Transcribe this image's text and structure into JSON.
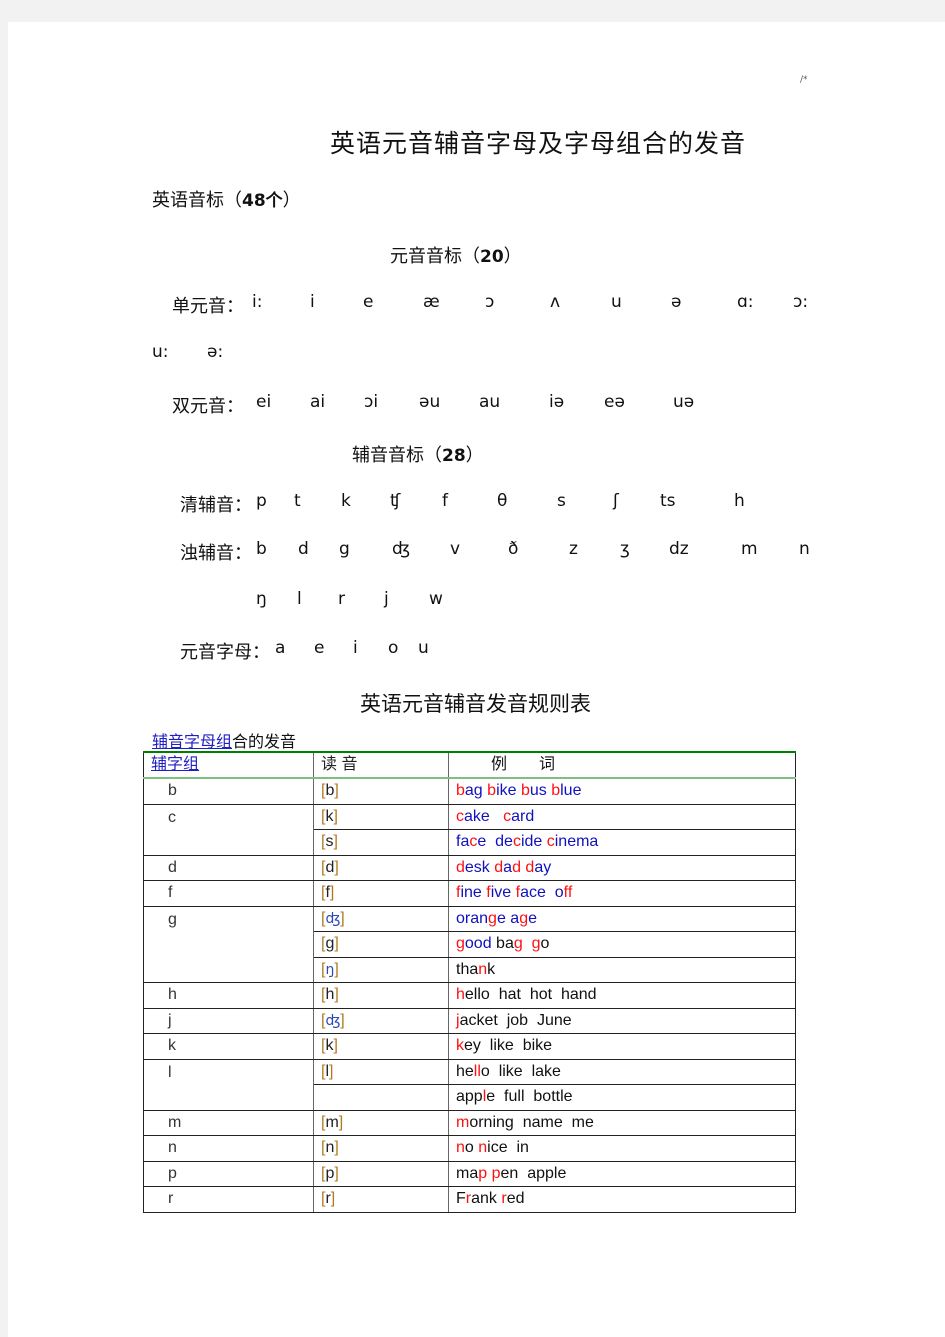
{
  "page_mark": "/*",
  "document_title": "英语元音辅音字母及字母组合的发音",
  "phonetics_heading": {
    "text": "英语音标（",
    "count": "48个",
    "close": "）"
  },
  "vowel_heading": {
    "text": "元音音标（",
    "count": "20",
    "close": "）"
  },
  "monophthongs": {
    "label": "单元音：",
    "symbols": [
      "i:",
      "i",
      "e",
      "æ",
      "ɔ",
      "ʌ",
      "u",
      "ə",
      "ɑ:",
      "ɔ:",
      "u:",
      "ə:"
    ]
  },
  "diphthongs": {
    "label": "双元音：",
    "symbols": [
      "ei",
      "ai",
      "ɔi",
      "əu",
      "au",
      "iə",
      "eə",
      "uə"
    ]
  },
  "consonant_heading": {
    "text": "辅音音标（",
    "count": "28",
    "close": "）"
  },
  "voiceless": {
    "label": "清辅音：",
    "symbols": [
      "p",
      "t",
      "k",
      "ʧ",
      "f",
      "θ",
      "s",
      "ʃ",
      "ts",
      "h"
    ]
  },
  "voiced": {
    "label": "浊辅音：",
    "symbols": [
      "b",
      "d",
      "g",
      "ʤ",
      "v",
      "ð",
      "z",
      "ʒ",
      "dz",
      "m",
      "n",
      "ŋ",
      "l",
      "r",
      "j",
      "w"
    ]
  },
  "vowel_letters": {
    "label": "元音字母：",
    "letters": [
      "a",
      "e",
      "i",
      "o",
      "u"
    ]
  },
  "table_title": "英语元音辅音发音规则表",
  "section_heading": {
    "link": "辅音字母组",
    "rest": "合的发音"
  },
  "table": {
    "headers": [
      "辅字组",
      "读 音",
      "例　　词"
    ],
    "rows": [
      {
        "group": "b",
        "sound": "b",
        "examples": [
          [
            "r",
            "b"
          ],
          [
            "b",
            "ag "
          ],
          [
            "r",
            "b"
          ],
          [
            "b",
            "ike "
          ],
          [
            "r",
            "b"
          ],
          [
            "b",
            "us "
          ],
          [
            "r",
            "b"
          ],
          [
            "b",
            "lue"
          ]
        ]
      },
      {
        "group": "c",
        "sound": "k",
        "examples": [
          [
            "r",
            "c"
          ],
          [
            "b",
            "ake   "
          ],
          [
            "r",
            "c"
          ],
          [
            "b",
            "ard"
          ]
        ]
      },
      {
        "group": "",
        "sound": "s",
        "examples": [
          [
            "b",
            "fa"
          ],
          [
            "r",
            "c"
          ],
          [
            "b",
            "e  de"
          ],
          [
            "r",
            "c"
          ],
          [
            "b",
            "ide "
          ],
          [
            "r",
            "c"
          ],
          [
            "b",
            "inema"
          ]
        ]
      },
      {
        "group": "d",
        "sound": "d",
        "examples": [
          [
            "r",
            "d"
          ],
          [
            "b",
            "esk "
          ],
          [
            "r",
            "d"
          ],
          [
            "b",
            "a"
          ],
          [
            "r",
            "d"
          ],
          [
            "b",
            " "
          ],
          [
            "r",
            "d"
          ],
          [
            "b",
            "ay"
          ]
        ]
      },
      {
        "group": "f",
        "sound": "f",
        "examples": [
          [
            "r",
            "f"
          ],
          [
            "b",
            "ine "
          ],
          [
            "r",
            "f"
          ],
          [
            "b",
            "ive "
          ],
          [
            "r",
            "f"
          ],
          [
            "b",
            "ace  o"
          ],
          [
            "r",
            "ff"
          ]
        ]
      },
      {
        "group": "g",
        "sound": "ʤ",
        "examples": [
          [
            "b",
            "oran"
          ],
          [
            "r",
            "g"
          ],
          [
            "b",
            "e a"
          ],
          [
            "r",
            "g"
          ],
          [
            "b",
            "e"
          ]
        ]
      },
      {
        "group": "",
        "sound": "g",
        "examples": [
          [
            "r",
            "g"
          ],
          [
            "b",
            "ood "
          ],
          [
            "k",
            "ba"
          ],
          [
            "r",
            "g"
          ],
          [
            "k",
            "  "
          ],
          [
            "r",
            "g"
          ],
          [
            "k",
            "o"
          ]
        ]
      },
      {
        "group": "",
        "sound": "ŋ",
        "examples": [
          [
            "k",
            "tha"
          ],
          [
            "r",
            "n"
          ],
          [
            "k",
            "k"
          ]
        ]
      },
      {
        "group": "h",
        "sound": "h",
        "examples": [
          [
            "r",
            "h"
          ],
          [
            "k",
            "ello  hat  hot  hand"
          ]
        ]
      },
      {
        "group": "j",
        "sound": "ʤ",
        "examples": [
          [
            "r",
            "j"
          ],
          [
            "k",
            "acket  job  June"
          ]
        ]
      },
      {
        "group": "k",
        "sound": "k",
        "examples": [
          [
            "r",
            "k"
          ],
          [
            "k",
            "ey  like  bike"
          ]
        ]
      },
      {
        "group": "l",
        "sound": "l",
        "examples": [
          [
            "k",
            "he"
          ],
          [
            "r",
            "ll"
          ],
          [
            "k",
            "o  like  lake"
          ]
        ]
      },
      {
        "group": "",
        "sound": "",
        "examples": [
          [
            "k",
            "app"
          ],
          [
            "r",
            "l"
          ],
          [
            "k",
            "e  full  bottle"
          ]
        ]
      },
      {
        "group": "m",
        "sound": "m",
        "examples": [
          [
            "r",
            "m"
          ],
          [
            "k",
            "orning  name  me"
          ]
        ]
      },
      {
        "group": "n",
        "sound": "n",
        "examples": [
          [
            "r",
            "n"
          ],
          [
            "k",
            "o "
          ],
          [
            "r",
            "n"
          ],
          [
            "k",
            "ice  in"
          ]
        ]
      },
      {
        "group": "p",
        "sound": "p",
        "examples": [
          [
            "k",
            "ma"
          ],
          [
            "r",
            "p"
          ],
          [
            "k",
            " "
          ],
          [
            "r",
            "p"
          ],
          [
            "k",
            "en  apple"
          ]
        ]
      },
      {
        "group": "r",
        "sound": "r",
        "examples": [
          [
            "k",
            "F"
          ],
          [
            "r",
            "r"
          ],
          [
            "k",
            "ank "
          ],
          [
            "r",
            "r"
          ],
          [
            "k",
            "ed"
          ]
        ]
      }
    ]
  },
  "colors": {
    "highlight_red": "#ff1010",
    "text_blue": "#1010c0",
    "link_blue": "#1f1fc4",
    "header_green": "#008000"
  }
}
